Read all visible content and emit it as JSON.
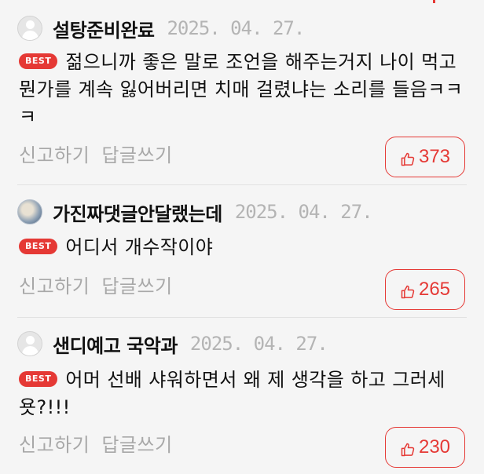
{
  "comments": [
    {
      "nickname": "설탕준비완료",
      "date": "2025. 04. 27.",
      "badge": "BEST",
      "text": "젊으니까 좋은 말로 조언을 해주는거지 나이 먹고 뭔가를 계속 잃어버리면 치매 걸렸냐는 소리를 들음ㅋㅋㅋ",
      "report_label": "신고하기",
      "reply_label": "답글쓰기",
      "likes": "373"
    },
    {
      "nickname": "가진짜댓글안달랬는데",
      "date": "2025. 04. 27.",
      "badge": "BEST",
      "text": "어디서 개수작이야",
      "report_label": "신고하기",
      "reply_label": "답글쓰기",
      "likes": "265"
    },
    {
      "nickname": "샌디예고 국악과",
      "date": "2025. 04. 27.",
      "badge": "BEST",
      "text": "어머 선배 샤워하면서 왜 제 생각을 하고 그러세욧?!!!",
      "report_label": "신고하기",
      "reply_label": "답글쓰기",
      "likes": "230"
    }
  ],
  "colors": {
    "accent": "#e53935",
    "muted": "#a8a8a8",
    "date": "#b4b4b4",
    "background": "#f5f5f5"
  },
  "icons": {
    "avatar": "default-user-avatar",
    "like": "thumbs-up-icon"
  }
}
